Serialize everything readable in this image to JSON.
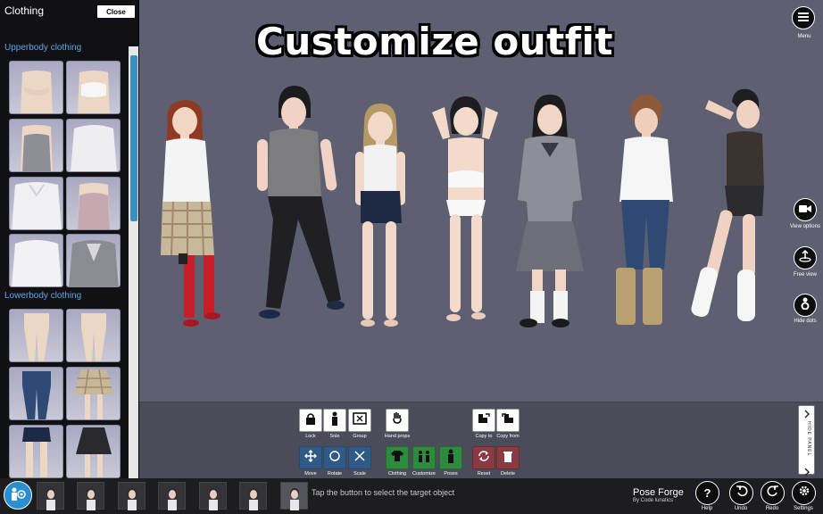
{
  "viewport": {
    "headline": "Customize outfit"
  },
  "panel": {
    "title": "Clothing",
    "close_label": "Close",
    "sections": [
      {
        "label": "Upperbody clothing"
      },
      {
        "label": "Lowerbody clothing"
      }
    ]
  },
  "side_buttons": {
    "menu": "Menu",
    "view_options": "View options",
    "free_view": "Free view",
    "hide_dots": "Hide dots"
  },
  "toolbar": {
    "lock": "Lock",
    "solo": "Solo",
    "group": "Group",
    "hand_props": "Hand props",
    "copy_to": "Copy to",
    "copy_from": "Copy from",
    "move": "Move",
    "rotate": "Rotate",
    "scale": "Scale",
    "clothing": "Clothing",
    "customize": "Customize",
    "poses": "Poses",
    "reset": "Reset",
    "delete": "Delete",
    "hide_panel": "HIDE PANEL"
  },
  "bottom_bar": {
    "hint": "Tap the button to select the target object",
    "brand": "Pose Forge",
    "brand_sub": "By Code lunatics",
    "help": "Help",
    "undo": "Undo",
    "redo": "Redo",
    "settings": "Settings"
  }
}
